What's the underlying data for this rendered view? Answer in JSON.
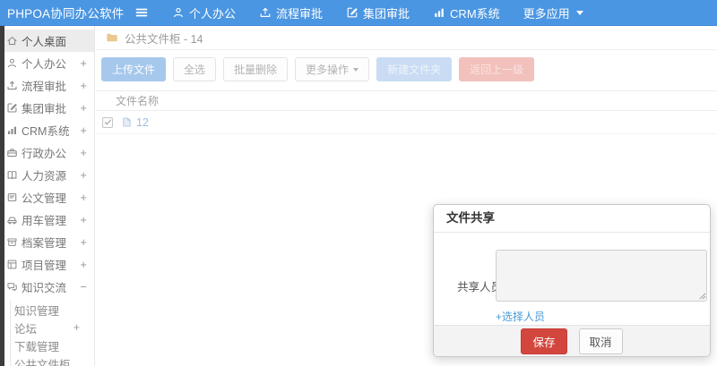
{
  "navbar": {
    "logo": "PHPOA协同办公软件",
    "items": [
      {
        "label": "个人办公",
        "icon": "user-icon"
      },
      {
        "label": "流程审批",
        "icon": "upload-icon"
      },
      {
        "label": "集团审批",
        "icon": "edit-icon"
      },
      {
        "label": "CRM系统",
        "icon": "bar-chart-icon"
      },
      {
        "label": "更多应用",
        "icon": "caret-down-icon"
      }
    ]
  },
  "sidebar": {
    "items": [
      {
        "label": "个人桌面",
        "icon": "home-icon",
        "expand": "",
        "active": true
      },
      {
        "label": "个人办公",
        "icon": "user-icon",
        "expand": "+"
      },
      {
        "label": "流程审批",
        "icon": "upload-icon",
        "expand": "+"
      },
      {
        "label": "集团审批",
        "icon": "edit-icon",
        "expand": "+"
      },
      {
        "label": "CRM系统",
        "icon": "bar-chart-icon",
        "expand": "+"
      },
      {
        "label": "行政办公",
        "icon": "briefcase-icon",
        "expand": "+"
      },
      {
        "label": "人力资源",
        "icon": "book-icon",
        "expand": "+"
      },
      {
        "label": "公文管理",
        "icon": "document-icon",
        "expand": "+"
      },
      {
        "label": "用车管理",
        "icon": "car-icon",
        "expand": "+"
      },
      {
        "label": "档案管理",
        "icon": "archive-icon",
        "expand": "+"
      },
      {
        "label": "项目管理",
        "icon": "project-icon",
        "expand": "+"
      },
      {
        "label": "知识交流",
        "icon": "chat-icon",
        "expand": "−",
        "expanded": true
      }
    ],
    "subitems": [
      {
        "label": "知识管理",
        "expand": ""
      },
      {
        "label": "论坛",
        "expand": "+"
      },
      {
        "label": "下载管理",
        "expand": ""
      },
      {
        "label": "公共文件柜",
        "expand": ""
      }
    ]
  },
  "main": {
    "breadcrumb": "公共文件柜 - 14",
    "toolbar": [
      {
        "label": "上传文件",
        "style": "primary"
      },
      {
        "label": "全选",
        "style": "default"
      },
      {
        "label": "批量删除",
        "style": "default"
      },
      {
        "label": "更多操作",
        "style": "default",
        "caret": true
      },
      {
        "label": "新建文件夹",
        "style": "info"
      },
      {
        "label": "返回上一级",
        "style": "danger"
      }
    ],
    "table": {
      "header": "文件名称",
      "rows": [
        {
          "name": "12",
          "checked": true
        }
      ]
    }
  },
  "modal": {
    "title": "文件共享",
    "field_label": "共享人员",
    "textarea_value": "",
    "link": "+选择人员",
    "save": "保存",
    "cancel": "取消"
  },
  "colors": {
    "navbar_bg": "#4b96e2",
    "active_item_bg": "#ececec",
    "folder_yellow": "#e9c98f",
    "save_red": "#d2463e",
    "link_blue": "#4a9ad7",
    "muted_link_blue": "#9fbede"
  }
}
